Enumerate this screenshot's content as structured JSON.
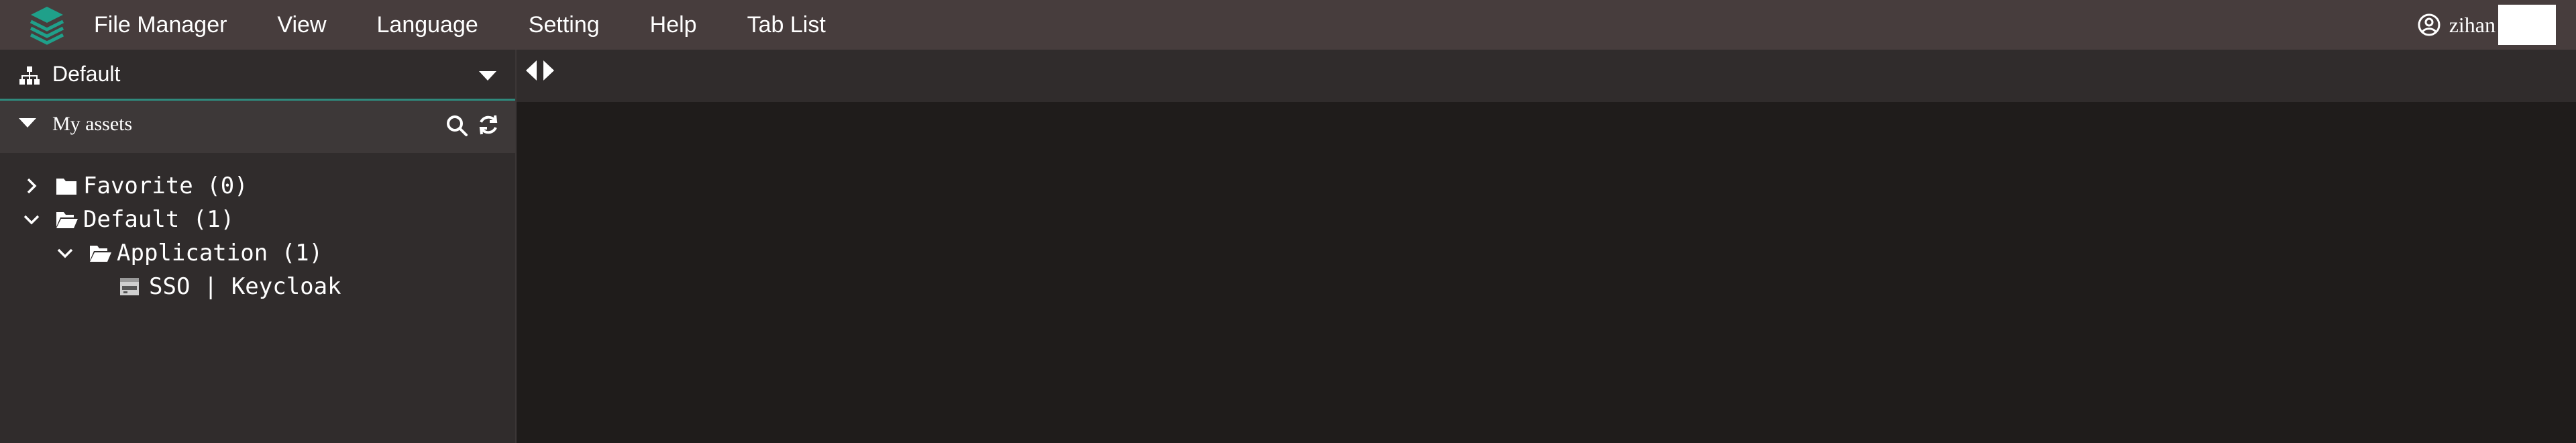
{
  "app": {
    "menu": [
      "File Manager",
      "View",
      "Language",
      "Setting",
      "Help",
      "Tab List"
    ],
    "user": {
      "name": "zihan"
    },
    "accent_color": "#2f8a7d",
    "logo_color": "#1fa08a"
  },
  "sidebar": {
    "workspace": {
      "label": "Default",
      "icon": "sitemap-icon"
    },
    "assets": {
      "label": "My assets"
    },
    "tree": [
      {
        "label": "Favorite (0)",
        "expanded": false,
        "icon": "folder-icon",
        "level": 0
      },
      {
        "label": "Default (1)",
        "expanded": true,
        "icon": "folder-open-icon",
        "level": 0
      },
      {
        "label": "Application (1)",
        "expanded": true,
        "icon": "folder-open-icon",
        "level": 1
      },
      {
        "label": "SSO | Keycloak",
        "icon": "web-app-icon",
        "level": 2
      }
    ]
  }
}
